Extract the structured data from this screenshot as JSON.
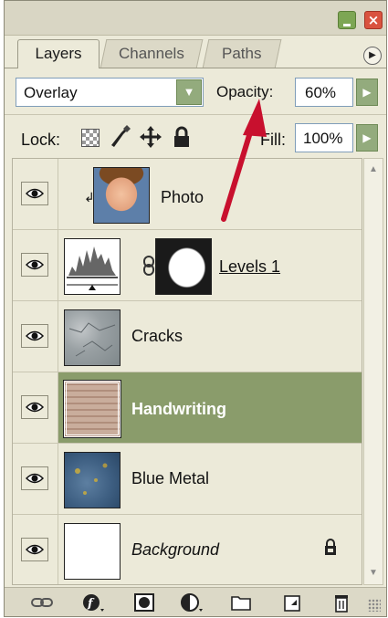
{
  "tabs": [
    {
      "label": "Layers",
      "active": true
    },
    {
      "label": "Channels",
      "active": false
    },
    {
      "label": "Paths",
      "active": false
    }
  ],
  "blend_mode": {
    "value": "Overlay"
  },
  "opacity": {
    "label": "Opacity:",
    "value": "60%"
  },
  "lock": {
    "label": "Lock:"
  },
  "fill": {
    "label": "Fill:",
    "value": "100%"
  },
  "layers": [
    {
      "name": "Photo",
      "visible": true,
      "clipped": true,
      "selected": false
    },
    {
      "name": "Levels 1",
      "visible": true,
      "type": "adjustment",
      "has_mask": true,
      "selected": false
    },
    {
      "name": "Cracks",
      "visible": true,
      "selected": false
    },
    {
      "name": "Handwriting",
      "visible": true,
      "selected": true
    },
    {
      "name": "Blue Metal",
      "visible": true,
      "selected": false
    },
    {
      "name": "Background",
      "visible": true,
      "locked": true,
      "italic": true,
      "selected": false
    }
  ],
  "colors": {
    "panel_bg": "#ecead9",
    "selected_row": "#8a9c6b",
    "accent_button": "#93ab7d",
    "close_button": "#d9533f",
    "annotation_arrow": "#c8102e"
  },
  "icons": {
    "title_bar": [
      "minimize-icon",
      "close-icon"
    ],
    "panel_menu": "panel-menu-icon",
    "lock": [
      "lock-transparent-pixels-icon",
      "lock-image-pixels-icon",
      "lock-position-icon",
      "lock-all-icon"
    ],
    "bottom_bar": [
      "link-icon",
      "layer-style-icon",
      "layer-mask-icon",
      "adjustment-layer-icon",
      "folder-icon",
      "new-layer-icon",
      "trash-icon"
    ]
  }
}
